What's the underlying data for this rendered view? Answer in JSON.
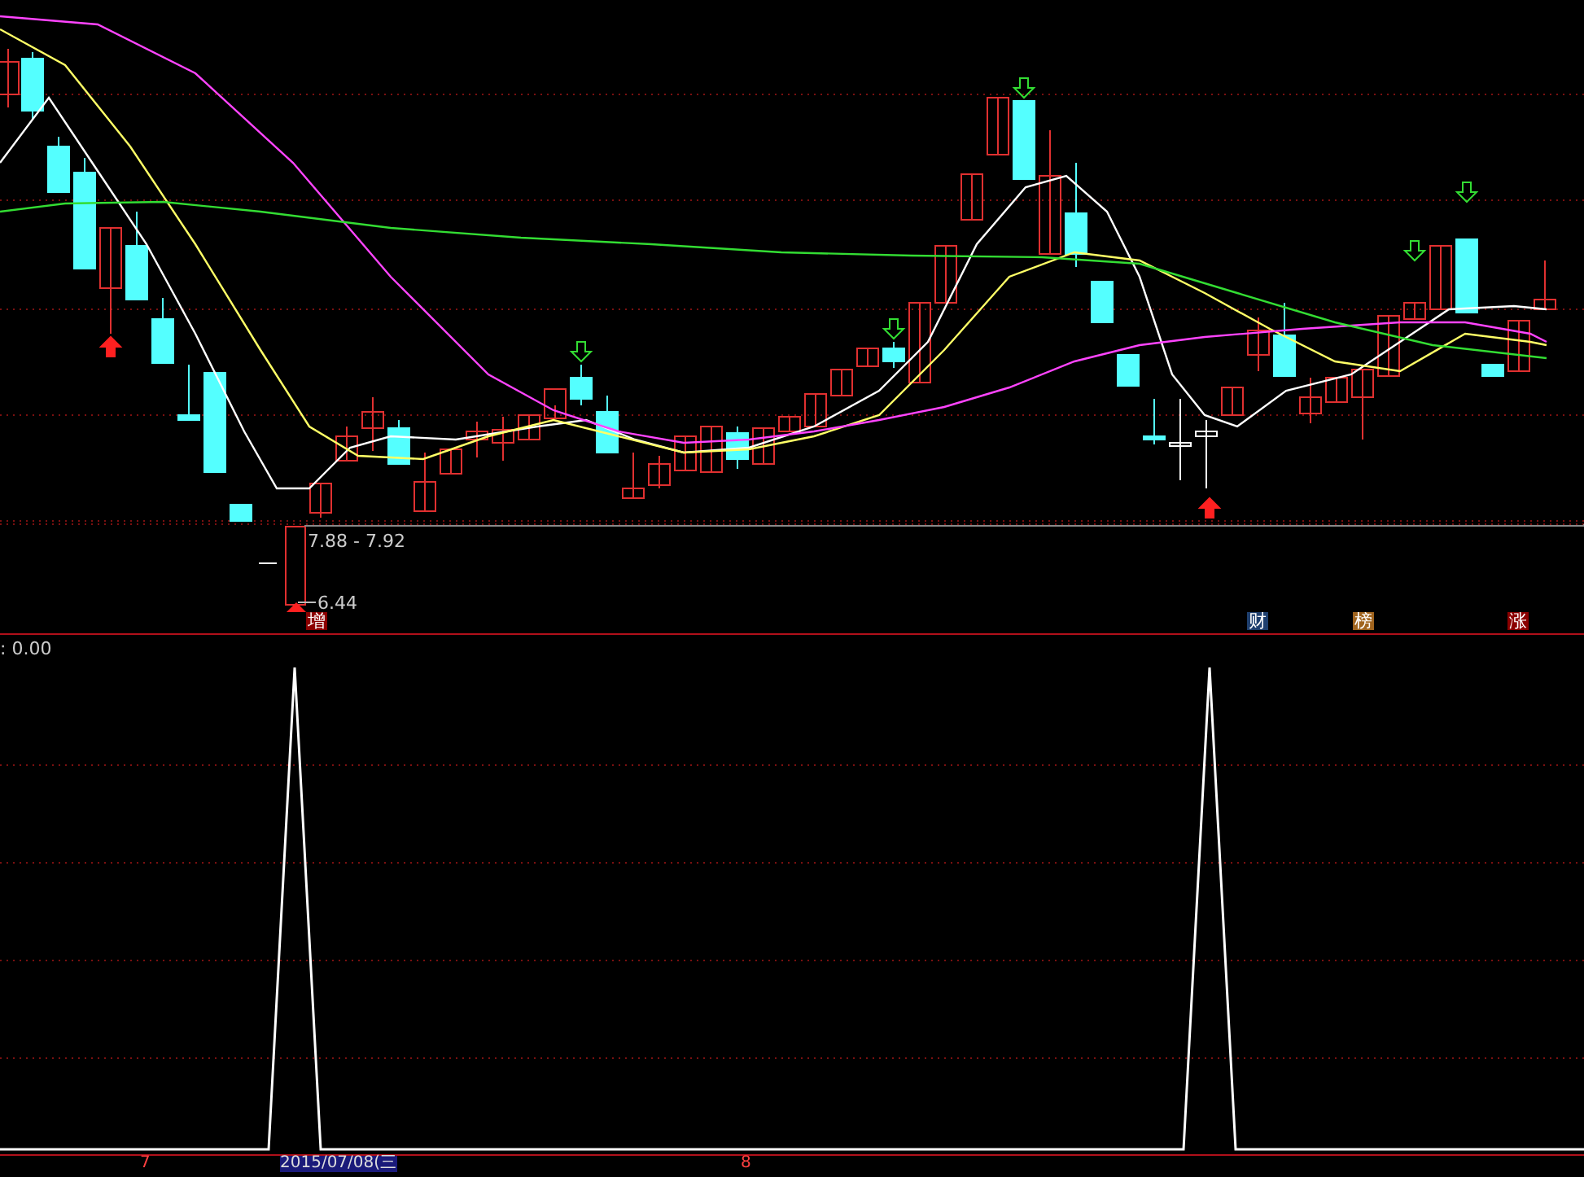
{
  "price_pane": {
    "range_label": "7.88 - 7.92",
    "low_label": "6.44",
    "event_tags": [
      {
        "text": "增",
        "color": "#8b0000"
      },
      {
        "text": "财",
        "color": "#1f3f6e"
      },
      {
        "text": "榜",
        "color": "#a0641e"
      },
      {
        "text": "涨",
        "color": "#8b0000"
      }
    ]
  },
  "indicator_pane": {
    "value_label": ": 0.00"
  },
  "date_axis": {
    "labels": [
      {
        "text": "7",
        "selected": false
      },
      {
        "text": "2015/07/08(三",
        "selected": true
      },
      {
        "text": "8",
        "selected": false
      }
    ]
  }
}
